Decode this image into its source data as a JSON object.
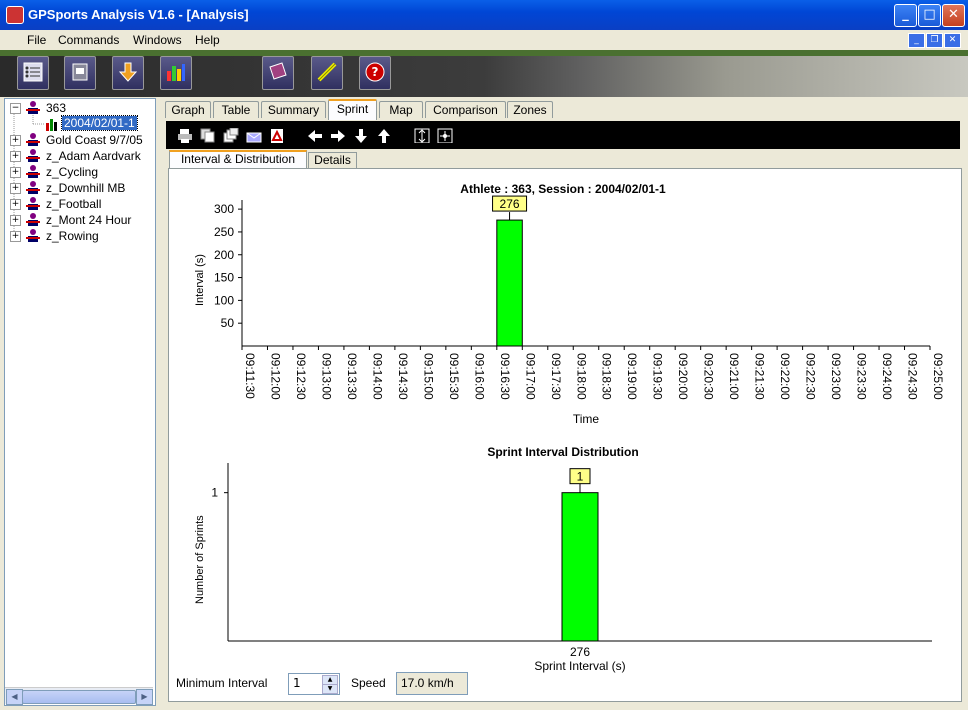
{
  "window": {
    "title": "GPSports Analysis V1.6 - [Analysis]"
  },
  "menu": [
    "File",
    "Commands",
    "Windows",
    "Help"
  ],
  "toolbar_icons": [
    "athlete-list-icon",
    "session-icon",
    "download-icon",
    "chart-icon",
    "book-icon",
    "wand-icon",
    "help-icon"
  ],
  "tree": [
    {
      "label": "363",
      "expanded": true
    },
    {
      "label": "2004/02/01-1",
      "selected": true
    },
    {
      "label": "Gold Coast 9/7/05"
    },
    {
      "label": "z_Adam Aardvark"
    },
    {
      "label": "z_Cycling"
    },
    {
      "label": "z_Downhill MB"
    },
    {
      "label": "z_Football"
    },
    {
      "label": "z_Mont 24 Hour"
    },
    {
      "label": "z_Rowing"
    }
  ],
  "tabs": [
    "Graph",
    "Table",
    "Summary",
    "Sprint",
    "Map",
    "Comparison",
    "Zones"
  ],
  "active_tab": "Sprint",
  "subtabs": [
    "Interval & Distribution",
    "Details"
  ],
  "bottom": {
    "min_interval_label": "Minimum Interval",
    "min_interval_value": "1",
    "speed_label": "Speed",
    "speed_value": "17.0  km/h"
  },
  "chart_data": [
    {
      "type": "bar",
      "title": "Athlete : 363, Session : 2004/02/01-1",
      "xlabel": "Time",
      "ylabel": "Interval (s)",
      "yticks": [
        50,
        100,
        150,
        200,
        250,
        300
      ],
      "categories": [
        "09:11:30",
        "09:12:00",
        "09:12:30",
        "09:13:00",
        "09:13:30",
        "09:14:00",
        "09:14:30",
        "09:15:00",
        "09:15:30",
        "09:16:00",
        "09:16:30",
        "09:17:00",
        "09:17:30",
        "09:18:00",
        "09:18:30",
        "09:19:00",
        "09:19:30",
        "09:20:00",
        "09:20:30",
        "09:21:00",
        "09:21:30",
        "09:22:00",
        "09:22:30",
        "09:23:00",
        "09:23:30",
        "09:24:00",
        "09:24:30",
        "09:25:00"
      ],
      "bars": [
        {
          "x_start": "09:16:30",
          "x_end": "09:17:00",
          "value": 276,
          "label": "276"
        }
      ],
      "ylim": [
        0,
        320
      ],
      "bar_color": "#00ff00"
    },
    {
      "type": "bar",
      "title": "Sprint Interval Distribution",
      "xlabel": "Sprint Interval (s)",
      "ylabel": "Number of Sprints",
      "yticks": [
        1
      ],
      "categories": [
        "276"
      ],
      "values": [
        1
      ],
      "labels": [
        "1"
      ],
      "ylim": [
        0,
        1.2
      ],
      "bar_color": "#00ff00"
    }
  ]
}
